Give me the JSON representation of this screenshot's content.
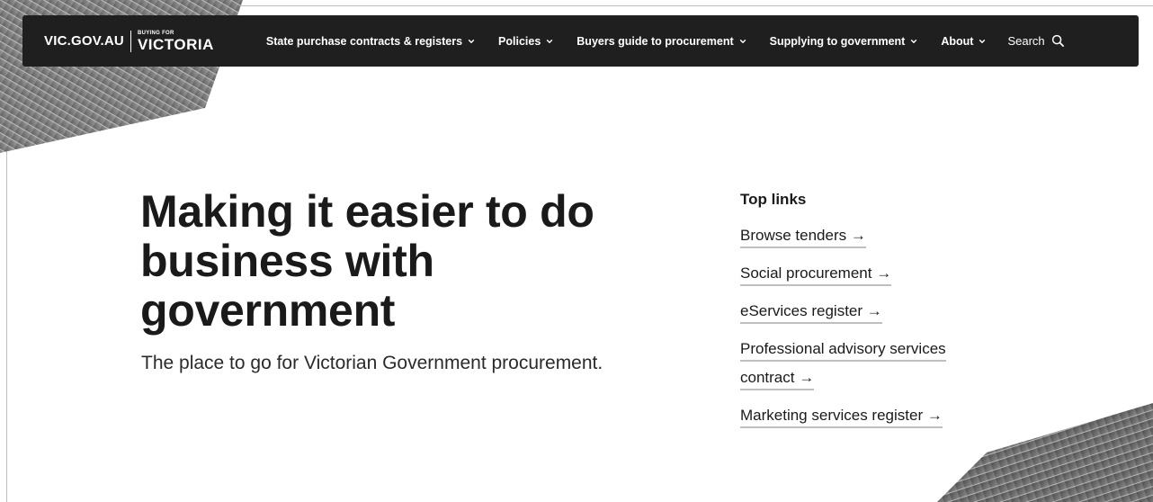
{
  "header": {
    "logo_vic": "VIC.GOV.AU",
    "logo_buying": "BUYING FOR",
    "logo_victoria": "VICTORIA",
    "nav": [
      {
        "label": "State purchase contracts & registers"
      },
      {
        "label": "Policies"
      },
      {
        "label": "Buyers guide to procurement"
      },
      {
        "label": "Supplying to government"
      },
      {
        "label": "About"
      }
    ],
    "search_label": "Search"
  },
  "hero": {
    "title": "Making it easier to do business with government",
    "subtitle": "The place to go for Victorian Government procurement."
  },
  "top_links": {
    "heading": "Top links",
    "links": [
      {
        "label": "Browse tenders"
      },
      {
        "label": "Social procurement"
      },
      {
        "label": "eServices register"
      },
      {
        "label": "Professional advisory services contract"
      },
      {
        "label": "Marketing services register"
      }
    ]
  },
  "colors": {
    "navbar": "#1f1f1f",
    "text": "#1a1a1a",
    "link_underline": "#bfbfbf"
  },
  "icons": [
    "chevron-down-icon",
    "search-icon",
    "arrow-right-icon"
  ]
}
